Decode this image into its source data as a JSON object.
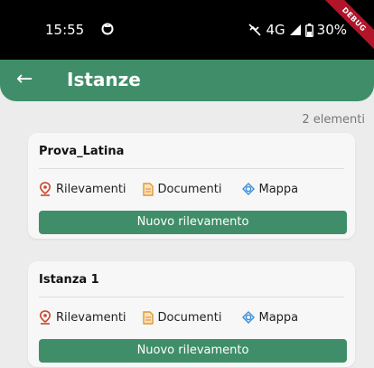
{
  "status_bar": {
    "time": "15:55",
    "network": "4G",
    "battery": "30%",
    "debug_label": "DEBUG"
  },
  "app_bar": {
    "title": "Istanze",
    "back_icon": "arrow-left-icon"
  },
  "list": {
    "count_label": "2 elementi",
    "items": [
      {
        "name": "Prova_Latina",
        "rilevamenti_label": "Rilevamenti",
        "documenti_label": "Documenti",
        "mappa_label": "Mappa",
        "button_label": "Nuovo rilevamento"
      },
      {
        "name": "Istanza 1",
        "rilevamenti_label": "Rilevamenti",
        "documenti_label": "Documenti",
        "mappa_label": "Mappa",
        "button_label": "Nuovo rilevamento"
      }
    ]
  },
  "colors": {
    "primary": "#3f8e69",
    "pin": "#c8462b",
    "document": "#e3962e",
    "map": "#3d8ed6"
  }
}
